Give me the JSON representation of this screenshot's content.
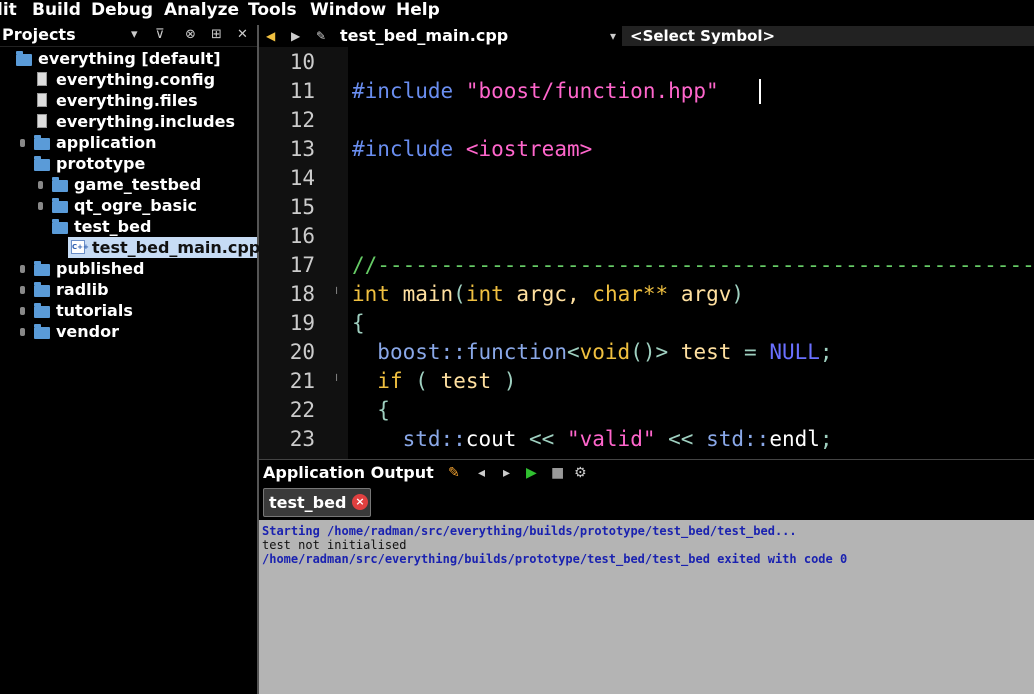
{
  "menu": {
    "items": [
      "lit",
      "Build",
      "Debug",
      "Analyze",
      "Tools",
      "Window",
      "Help"
    ]
  },
  "projects": {
    "title": "Projects",
    "tree": [
      {
        "label": "everything [default]",
        "kind": "project"
      },
      {
        "label": "everything.config",
        "kind": "file"
      },
      {
        "label": "everything.files",
        "kind": "file"
      },
      {
        "label": "everything.includes",
        "kind": "file"
      },
      {
        "label": "application",
        "kind": "folder"
      },
      {
        "label": "prototype",
        "kind": "folder"
      },
      {
        "label": "game_testbed",
        "kind": "folder"
      },
      {
        "label": "qt_ogre_basic",
        "kind": "folder"
      },
      {
        "label": "test_bed",
        "kind": "folder"
      },
      {
        "label": "test_bed_main.cpp",
        "kind": "cpp",
        "selected": true
      },
      {
        "label": "published",
        "kind": "folder"
      },
      {
        "label": "radlib",
        "kind": "folder"
      },
      {
        "label": "tutorials",
        "kind": "folder"
      },
      {
        "label": "vendor",
        "kind": "folder"
      }
    ]
  },
  "editor": {
    "file_name": "test_bed_main.cpp",
    "symbol": "<Select Symbol>",
    "line_numbers": [
      "10",
      "11",
      "12",
      "13",
      "14",
      "15",
      "16",
      "17",
      "18",
      "19",
      "20",
      "21",
      "22",
      "23"
    ],
    "lines": {
      "l11_dir": "#include",
      "l11_str": "\"boost/function.hpp\"",
      "l13_dir": "#include",
      "l13_str": "<iostream>",
      "l17": "//------------------------------------------------------------",
      "l18_int": "int",
      "l18_main": "main",
      "l18_open": "(",
      "l18_int2": "int",
      "l18_argc": "argc,",
      "l18_char": "char**",
      "l18_argv": "argv",
      "l18_close": ")",
      "l19": "{",
      "l20_ns": "boost::",
      "l20_fn": "function",
      "l20_lt": "<",
      "l20_void": "void",
      "l20_sig": "()>",
      "l20_test": "test",
      "l20_eq": "=",
      "l20_null": "NULL",
      "l20_semi": ";",
      "l21_if": "if",
      "l21_open": "(",
      "l21_test": "test",
      "l21_close": ")",
      "l22": "{",
      "l23_std": "std::",
      "l23_cout": "cout",
      "l23_op": "<<",
      "l23_str": "\"valid\"",
      "l23_op2": "<<",
      "l23_std2": "std::",
      "l23_endl": "endl",
      "l23_semi": ";"
    }
  },
  "output": {
    "title": "Application Output",
    "tab_label": "test_bed",
    "lines": [
      "Starting /home/radman/src/everything/builds/prototype/test_bed/test_bed...",
      "test not initialised",
      "/home/radman/src/everything/builds/prototype/test_bed/test_bed exited with code 0"
    ]
  },
  "colors": {
    "keyword": "#f0c040",
    "preprocessor": "#6a8ef0",
    "string": "#ff66cc",
    "comment": "#66cc66",
    "selection": "#c7dcf5",
    "output_bg": "#b4b4b4"
  }
}
